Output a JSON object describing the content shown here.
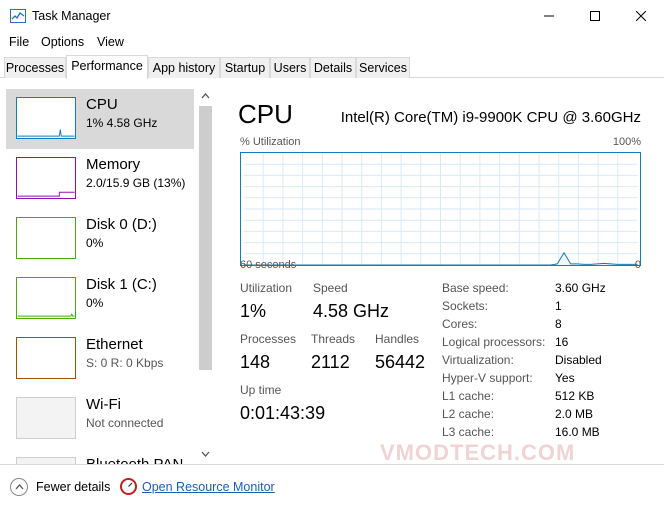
{
  "window": {
    "title": "Task Manager"
  },
  "menu": [
    "File",
    "Options",
    "View"
  ],
  "tabs": [
    "Processes",
    "Performance",
    "App history",
    "Startup",
    "Users",
    "Details",
    "Services"
  ],
  "active_tab": "Performance",
  "resources": [
    {
      "name": "CPU",
      "sub": "1% 4.58 GHz",
      "color": "#117dbb"
    },
    {
      "name": "Memory",
      "sub": "2.0/15.9 GB (13%)",
      "color": "#8b12ae"
    },
    {
      "name": "Disk 0 (D:)",
      "sub": "0%",
      "color": "#4da60c"
    },
    {
      "name": "Disk 1 (C:)",
      "sub": "0%",
      "color": "#4da60c"
    },
    {
      "name": "Ethernet",
      "sub": "S: 0 R: 0 Kbps",
      "color": "#a74f01"
    },
    {
      "name": "Wi-Fi",
      "sub": "Not connected",
      "color": "#a74f01"
    },
    {
      "name": "Bluetooth PAN",
      "sub": "",
      "color": "#a74f01"
    }
  ],
  "cpu": {
    "title": "CPU",
    "model": "Intel(R) Core(TM) i9-9900K CPU @ 3.60GHz",
    "util_label": "% Utilization",
    "util_max": "100%",
    "time_label": "60 seconds",
    "time_min": "0",
    "graph_color": "#117dbb",
    "graph_values": [
      0,
      0,
      0,
      0,
      0,
      0,
      0,
      0,
      0,
      0,
      0,
      0,
      0,
      0,
      0,
      0,
      0,
      0,
      0,
      0,
      0,
      0,
      0,
      0,
      0,
      0,
      0,
      0,
      0,
      0,
      0,
      0,
      0,
      0,
      0,
      0,
      0,
      0,
      0,
      0,
      0,
      0,
      0,
      0,
      0,
      0,
      0,
      1,
      11,
      1,
      1,
      0.5,
      0.5,
      1,
      1.5,
      1,
      0.5,
      0.5,
      0.5,
      0.5
    ]
  },
  "stats": {
    "utilization_label": "Utilization",
    "utilization": "1%",
    "speed_label": "Speed",
    "speed": "4.58 GHz",
    "processes_label": "Processes",
    "processes": "148",
    "threads_label": "Threads",
    "threads": "2112",
    "handles_label": "Handles",
    "handles": "56442",
    "uptime_label": "Up time",
    "uptime": "0:01:43:39"
  },
  "specs": [
    {
      "label": "Base speed:",
      "value": "3.60 GHz"
    },
    {
      "label": "Sockets:",
      "value": "1"
    },
    {
      "label": "Cores:",
      "value": "8"
    },
    {
      "label": "Logical processors:",
      "value": "16"
    },
    {
      "label": "Virtualization:",
      "value": "Disabled"
    },
    {
      "label": "Hyper-V support:",
      "value": "Yes"
    },
    {
      "label": "L1 cache:",
      "value": "512 KB"
    },
    {
      "label": "L2 cache:",
      "value": "2.0 MB"
    },
    {
      "label": "L3 cache:",
      "value": "16.0 MB"
    }
  ],
  "watermark": "VMODTECH.COM",
  "footer": {
    "fewer_details": "Fewer details",
    "resource_monitor": "Open Resource Monitor"
  }
}
